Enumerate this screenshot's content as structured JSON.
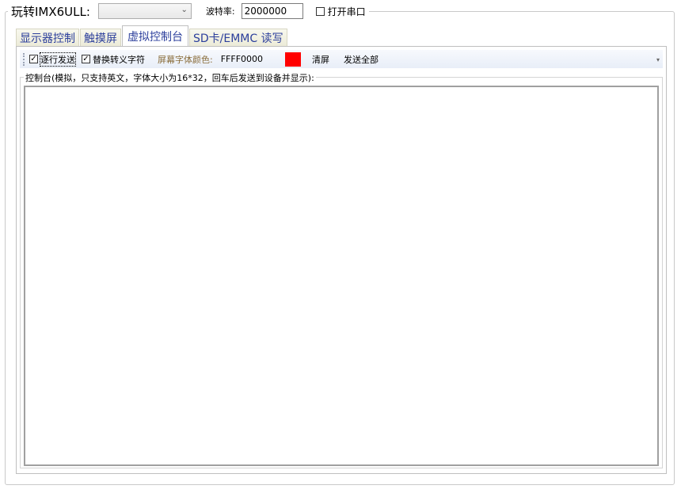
{
  "header": {
    "title": "玩转IMX6ULL:",
    "device_select_value": "",
    "baud_label": "波特率:",
    "baud_value": "2000000",
    "open_port_label": "打开串口",
    "open_port_checked": false
  },
  "tabs": [
    {
      "label": "显示器控制",
      "active": false
    },
    {
      "label": "触摸屏",
      "active": false
    },
    {
      "label": "虚拟控制台",
      "active": true
    },
    {
      "label": "SD卡/EMMC 读写",
      "active": false
    }
  ],
  "toolbar": {
    "line_send_label": "逐行发送",
    "line_send_checked": true,
    "escape_label": "替换转义字符",
    "escape_checked": true,
    "font_color_label": "屏幕字体颜色:",
    "font_color_value": "FFFF0000",
    "swatch_color": "#FF0000",
    "clear_label": "清屏",
    "send_all_label": "发送全部"
  },
  "console": {
    "legend": "控制台(模拟，只支持英文，字体大小为16*32，回车后发送到设备并显示):",
    "content": ""
  }
}
